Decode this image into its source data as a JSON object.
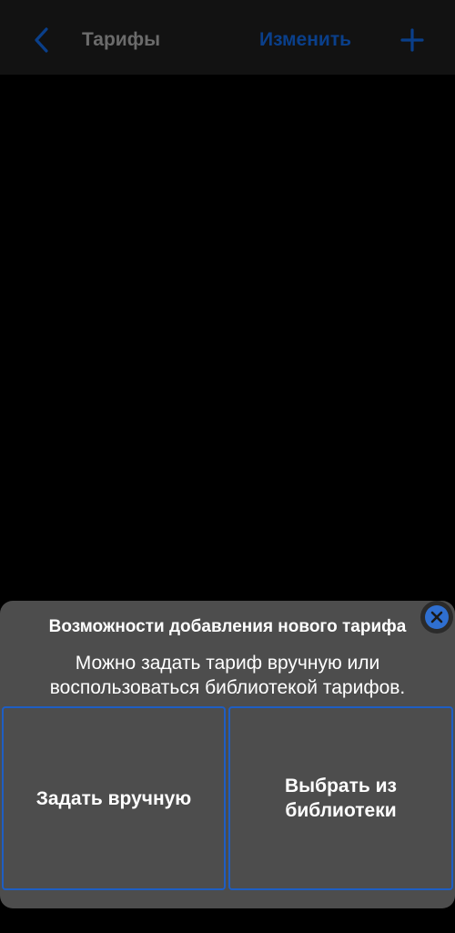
{
  "navbar": {
    "title": "Тарифы",
    "edit_label": "Изменить",
    "back_icon": "chevron-left-icon",
    "add_icon": "plus-icon"
  },
  "sheet": {
    "title": "Возможности добавления нового тарифа",
    "description": "Можно задать тариф вручную или воспользоваться библиотекой тарифов.",
    "close_icon": "close-icon",
    "options": [
      {
        "label": "Задать вручную"
      },
      {
        "label": "Выбрать из библиотеки"
      }
    ]
  },
  "colors": {
    "accent": "#1e5ec4",
    "nav_accent_dim": "#0a3f8a",
    "sheet_background": "#4d4d4d",
    "background": "#000000"
  }
}
